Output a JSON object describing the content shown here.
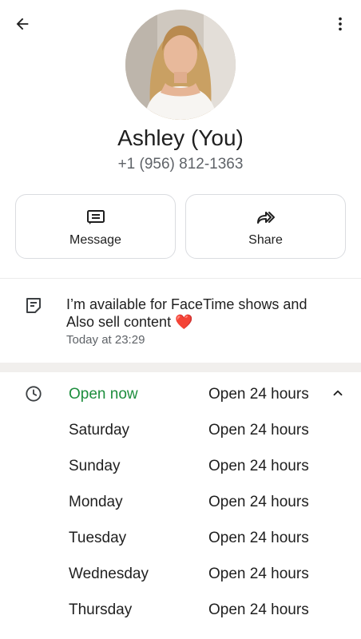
{
  "profile": {
    "name": "Ashley (You)",
    "phone": "+1 (956) 812-1363"
  },
  "icons": {
    "back": "arrow-left-icon",
    "more": "more-vert-icon",
    "message": "message-icon",
    "share": "share-forward-icon",
    "note": "note-icon",
    "clock": "clock-icon",
    "collapse": "chevron-up-icon",
    "heart": "heart-emoji"
  },
  "actions": {
    "message_label": "Message",
    "share_label": "Share"
  },
  "status": {
    "line1": "I’m available for FaceTime shows and",
    "line2": "Also sell content",
    "emoji": "❤️",
    "time": "Today at 23:29"
  },
  "hours": {
    "status_now": "Open now",
    "rows": [
      {
        "day": "Open now",
        "hours": "Open 24 hours"
      },
      {
        "day": "Saturday",
        "hours": "Open 24 hours"
      },
      {
        "day": "Sunday",
        "hours": "Open 24 hours"
      },
      {
        "day": "Monday",
        "hours": "Open 24 hours"
      },
      {
        "day": "Tuesday",
        "hours": "Open 24 hours"
      },
      {
        "day": "Wednesday",
        "hours": "Open 24 hours"
      },
      {
        "day": "Thursday",
        "hours": "Open 24 hours"
      }
    ]
  },
  "colors": {
    "open_green": "#1e8e3e",
    "text_primary": "#1f1f1f",
    "text_secondary": "#5f6368",
    "heart_red": "#e53935"
  }
}
